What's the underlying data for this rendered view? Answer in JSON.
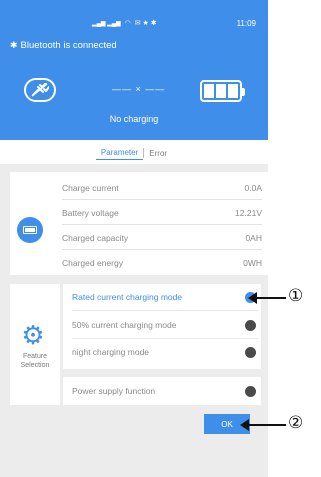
{
  "status_bar": {
    "signal": "▂▄▆ ▂▄▆",
    "wifi": "◠",
    "icons": "✉ ★ ✱",
    "battery": "▭",
    "time": "11:09"
  },
  "header": {
    "bluetooth_icon": "✱",
    "bluetooth_text": "Bluetooth is connected",
    "plug_icon": "plug-icon",
    "link_text": "—— × ——",
    "charge_status": "No charging",
    "battery_icon": "battery-full-icon"
  },
  "tabs": [
    {
      "label": "Parameter",
      "active": true
    },
    {
      "label": "Error",
      "active": false
    }
  ],
  "parameters": {
    "icon": "battery-icon",
    "rows": [
      {
        "label": "Charge current",
        "value": "0.0A"
      },
      {
        "label": "Battery voltage",
        "value": "12.21V"
      },
      {
        "label": "Charged capacity",
        "value": "0AH"
      },
      {
        "label": "Charged energy",
        "value": "0WH"
      }
    ]
  },
  "feature": {
    "icon": "gear-icon",
    "label_line1": "Feature",
    "label_line2": "Selection",
    "modes": [
      {
        "label": "Rated current charging mode",
        "selected": true
      },
      {
        "label": "50% current charging mode",
        "selected": false
      },
      {
        "label": "night charging mode",
        "selected": false
      }
    ],
    "supply": {
      "label": "Power supply function",
      "enabled": false
    }
  },
  "ok_button": {
    "label": "OK"
  },
  "annotations": {
    "one": "①",
    "two": "②"
  },
  "colors": {
    "accent": "#3f8eea",
    "background": "#ececec",
    "inactive_dot": "#4a4a4a"
  }
}
